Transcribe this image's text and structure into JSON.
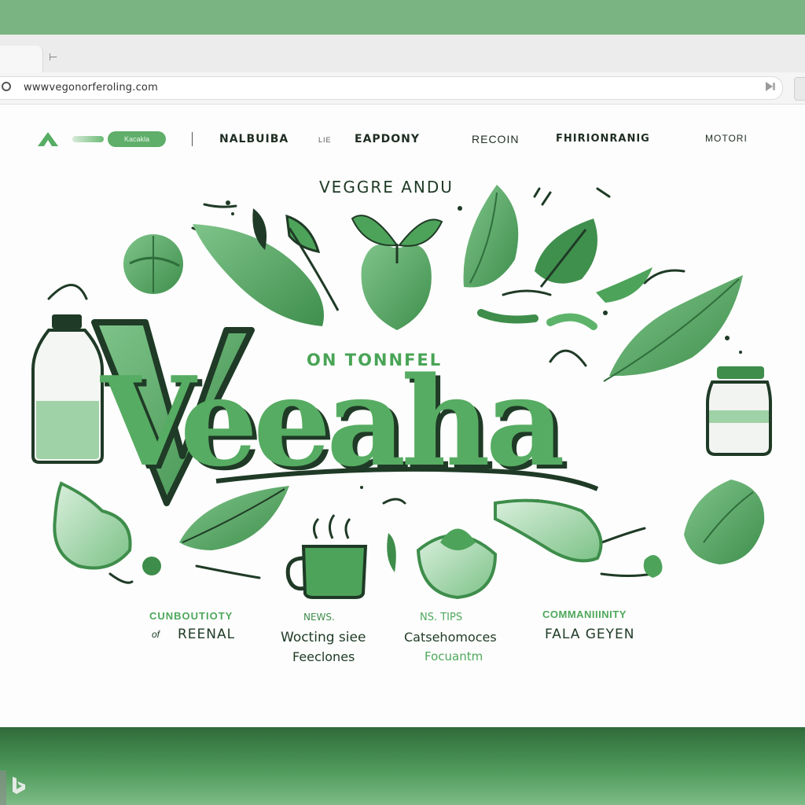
{
  "browser": {
    "new_tab_glyph": "⊢",
    "address": "wwwvegonorferoling.com"
  },
  "site": {
    "pill_label": "Kacakla",
    "nav": [
      "NALBUIBA",
      "LIE",
      "EAPDONY",
      "RECOIN",
      "FHIRIONRANIG",
      "MOTORI"
    ]
  },
  "hero": {
    "kicker": "VEGGRE ANDU",
    "subtitle": "ON TONNFEL",
    "title": "Veeaha"
  },
  "features": [
    {
      "heading": "CUNBOUTIOTY",
      "line1": "REENAL",
      "line1_prefix": "of",
      "line2": ""
    },
    {
      "heading": "NEWS.",
      "line1": "Wocting siee",
      "line2": "Feeclones"
    },
    {
      "heading": "NS. TIPS",
      "line1": "Catsehomoces",
      "line2": "Focuantm"
    },
    {
      "heading": "COMMANIIINITY",
      "line1": "FALA GEYEN",
      "line2": ""
    }
  ],
  "colors": {
    "brand": "#5aa965",
    "dark": "#1f3a26",
    "light": "#a8d7ae"
  }
}
